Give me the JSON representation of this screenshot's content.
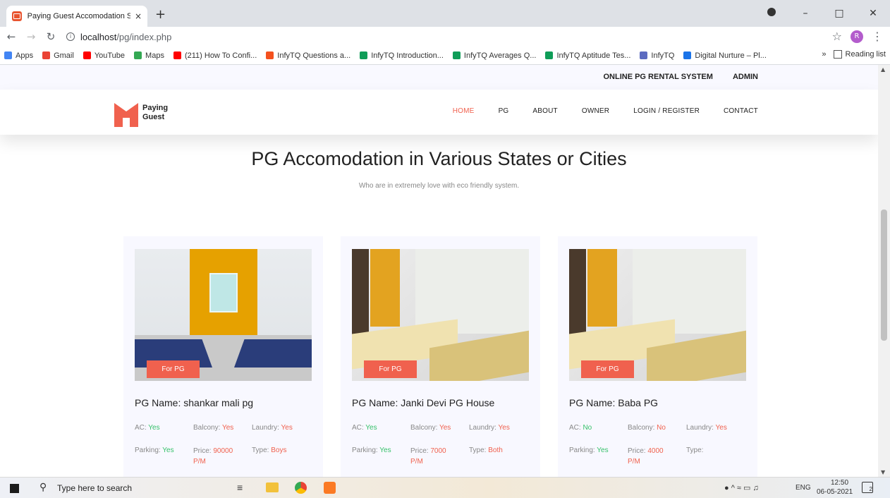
{
  "browser": {
    "tab_title": "Paying Guest Accomodation Syst",
    "tab_close": "×",
    "new_tab": "+",
    "url_host": "localhost",
    "url_path": "/pg/index.php",
    "bookmarks": [
      {
        "label": "Apps",
        "color": "#4285f4"
      },
      {
        "label": "Gmail",
        "color": "#ea4335"
      },
      {
        "label": "YouTube",
        "color": "#ff0000"
      },
      {
        "label": "Maps",
        "color": "#34a853"
      },
      {
        "label": "(211) How To Confi...",
        "color": "#ff0000"
      },
      {
        "label": "InfyTQ Questions a...",
        "color": "#f4511e"
      },
      {
        "label": "InfyTQ Introduction...",
        "color": "#0f9d58"
      },
      {
        "label": "InfyTQ Averages Q...",
        "color": "#0f9d58"
      },
      {
        "label": "InfyTQ Aptitude Tes...",
        "color": "#0f9d58"
      },
      {
        "label": "InfyTQ",
        "color": "#5c6bc0"
      },
      {
        "label": "Digital Nurture – Pl...",
        "color": "#1a73e8"
      }
    ],
    "more_bookmarks": "»",
    "reading_list": "Reading list",
    "profile_initial": "R"
  },
  "site": {
    "top_links": [
      "ONLINE PG RENTAL SYSTEM",
      "ADMIN"
    ],
    "logo": {
      "line1": "Paying",
      "line2": "Guest"
    },
    "nav": [
      "HOME",
      "PG",
      "ABOUT",
      "OWNER",
      "LOGIN / REGISTER",
      "CONTACT"
    ],
    "active_nav": "HOME",
    "title": "PG Accomodation in Various States or Cities",
    "subtitle": "Who are in extremely love with eco friendly system."
  },
  "cards": [
    {
      "badge": "For PG",
      "name": "PG Name: shankar mali pg",
      "ac_label": "AC:",
      "ac": "Yes",
      "balcony_label": "Balcony:",
      "balcony": "Yes",
      "laundry_label": "Laundry:",
      "laundry": "Yes",
      "parking_label": "Parking:",
      "parking": "Yes",
      "price_label": "Price:",
      "price": "90000 P/M",
      "type_label": "Type:",
      "type": "Boys"
    },
    {
      "badge": "For PG",
      "name": "PG Name: Janki Devi PG House",
      "ac_label": "AC:",
      "ac": "Yes",
      "balcony_label": "Balcony:",
      "balcony": "Yes",
      "laundry_label": "Laundry:",
      "laundry": "Yes",
      "parking_label": "Parking:",
      "parking": "Yes",
      "price_label": "Price:",
      "price": "7000 P/M",
      "type_label": "Type:",
      "type": "Both"
    },
    {
      "badge": "For PG",
      "name": "PG Name: Baba PG",
      "ac_label": "AC:",
      "ac": "No",
      "balcony_label": "Balcony:",
      "balcony": "No",
      "laundry_label": "Laundry:",
      "laundry": "Yes",
      "parking_label": "Parking:",
      "parking": "Yes",
      "price_label": "Price:",
      "price": "4000 P/M",
      "type_label": "Type:",
      "type": ""
    }
  ],
  "taskbar": {
    "search_placeholder": "Type here to search",
    "lang": "ENG",
    "time": "12:50",
    "date": "06-05-2021",
    "notif_count": "2"
  },
  "colors": {
    "accent": "#f0614e",
    "yes_green": "#36c16a"
  }
}
